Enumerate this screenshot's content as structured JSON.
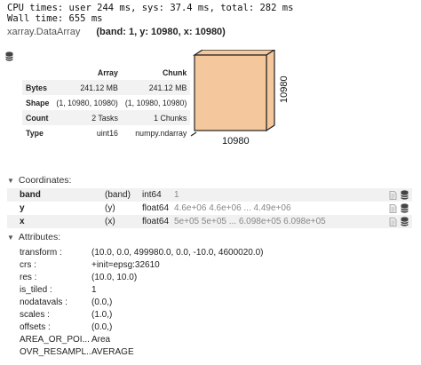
{
  "timing": {
    "line1": "CPU times: user 244 ms, sys: 37.4 ms, total: 282 ms",
    "line2": "Wall time: 655 ms"
  },
  "header": {
    "type": "xarray.DataArray",
    "dims": "(band: 1, y: 10980, x: 10980)"
  },
  "summary": {
    "col_array": "Array",
    "col_chunk": "Chunk",
    "rows": [
      {
        "label": "Bytes",
        "array": "241.12 MB",
        "chunk": "241.12 MB"
      },
      {
        "label": "Shape",
        "array": "(1, 10980, 10980)",
        "chunk": "(1, 10980, 10980)"
      },
      {
        "label": "Count",
        "array": "2 Tasks",
        "chunk": "1 Chunks"
      },
      {
        "label": "Type",
        "array": "uint16",
        "chunk": "numpy.ndarray"
      }
    ]
  },
  "cube": {
    "bottom_label": "10980",
    "side_label": "10980",
    "fill": "#f4c79c"
  },
  "coordinates": {
    "title": "Coordinates:",
    "rows": [
      {
        "name": "band",
        "dims": "(band)",
        "dtype": "int64",
        "preview": "1"
      },
      {
        "name": "y",
        "dims": "(y)",
        "dtype": "float64",
        "preview": "4.6e+06 4.6e+06 ... 4.49e+06"
      },
      {
        "name": "x",
        "dims": "(x)",
        "dtype": "float64",
        "preview": "5e+05 5e+05 ... 6.098e+05 6.098e+05"
      }
    ]
  },
  "attributes": {
    "title": "Attributes:",
    "rows": [
      {
        "name": "transform :",
        "value": "(10.0, 0.0, 499980.0, 0.0, -10.0, 4600020.0)"
      },
      {
        "name": "crs :",
        "value": "+init=epsg:32610"
      },
      {
        "name": "res :",
        "value": "(10.0, 10.0)"
      },
      {
        "name": "is_tiled :",
        "value": "1"
      },
      {
        "name": "nodatavals :",
        "value": "(0.0,)"
      },
      {
        "name": "scales :",
        "value": "(1.0,)"
      },
      {
        "name": "offsets :",
        "value": "(0.0,)"
      },
      {
        "name": "AREA_OR_POI... :",
        "value": "Area"
      },
      {
        "name": "OVR_RESAMPL... :",
        "value": "AVERAGE"
      }
    ]
  }
}
